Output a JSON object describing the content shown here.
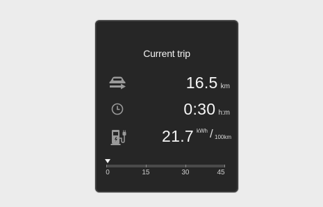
{
  "trip": {
    "title": "Current trip",
    "distance": {
      "value": "16.5",
      "unit": "km",
      "icon": "car-arrow-icon"
    },
    "time": {
      "value": "0:30",
      "unit": "h:m",
      "icon": "clock-icon"
    },
    "consumption": {
      "value": "21.7",
      "unit_top": "kWh",
      "unit_bottom": "100km",
      "icon": "ev-charger-icon"
    }
  },
  "scale": {
    "labels": [
      "0",
      "15",
      "30",
      "45"
    ],
    "marker_value": 0
  },
  "colors": {
    "page_background": "#ececec",
    "panel_background": "#262626",
    "text": "#f5f5f5",
    "icon": "#9a9a9a"
  }
}
